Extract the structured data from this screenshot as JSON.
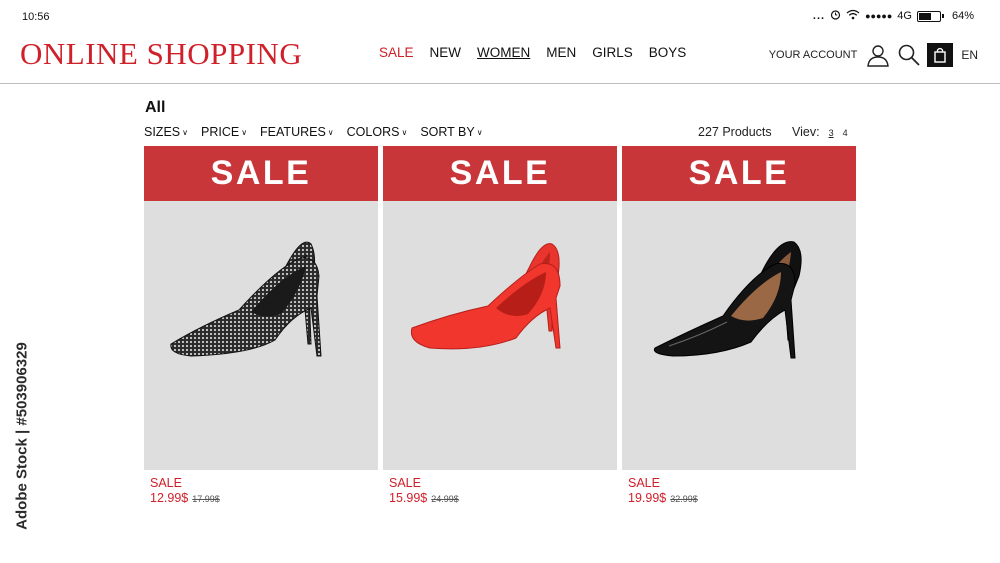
{
  "status_bar": {
    "time": "10:56",
    "dots": "...",
    "signal_dots": "●●●●●",
    "network": "4G",
    "battery_percent": "64%",
    "battery_level": 0.64
  },
  "header": {
    "logo": "ONLINE SHOPPING",
    "nav": [
      {
        "label": "SALE",
        "active_color": "#d0202a"
      },
      {
        "label": "NEW"
      },
      {
        "label": "WOMEN",
        "selected": true
      },
      {
        "label": "MEN"
      },
      {
        "label": "GIRLS"
      },
      {
        "label": "BOYS"
      }
    ],
    "account_label": "YOUR ACCOUNT",
    "icons": [
      "user-icon",
      "search-icon",
      "shopping-bag-icon"
    ],
    "language": "EN"
  },
  "listing": {
    "title": "All",
    "filters": [
      "SIZES",
      "PRICE",
      "FEATURES",
      "COLORS",
      "SORT BY"
    ],
    "product_count": "227 Products",
    "view_label": "Viev:",
    "view_options": [
      "3",
      "4"
    ],
    "view_selected": "3"
  },
  "products": [
    {
      "banner": "SALE",
      "sale_label": "SALE",
      "price": "12.99$",
      "old_price": "17.99$",
      "image": "black-rhinestone-pumps"
    },
    {
      "banner": "SALE",
      "sale_label": "SALE",
      "price": "15.99$",
      "old_price": "24.99$",
      "image": "red-suede-pumps"
    },
    {
      "banner": "SALE",
      "sale_label": "SALE",
      "price": "19.99$",
      "old_price": "32.99$",
      "image": "black-patent-pumps"
    }
  ],
  "watermark": "Adobe Stock | #503906329",
  "colors": {
    "brand_red": "#d0202a",
    "banner_red": "#c8363a",
    "card_bg": "#dedede"
  }
}
